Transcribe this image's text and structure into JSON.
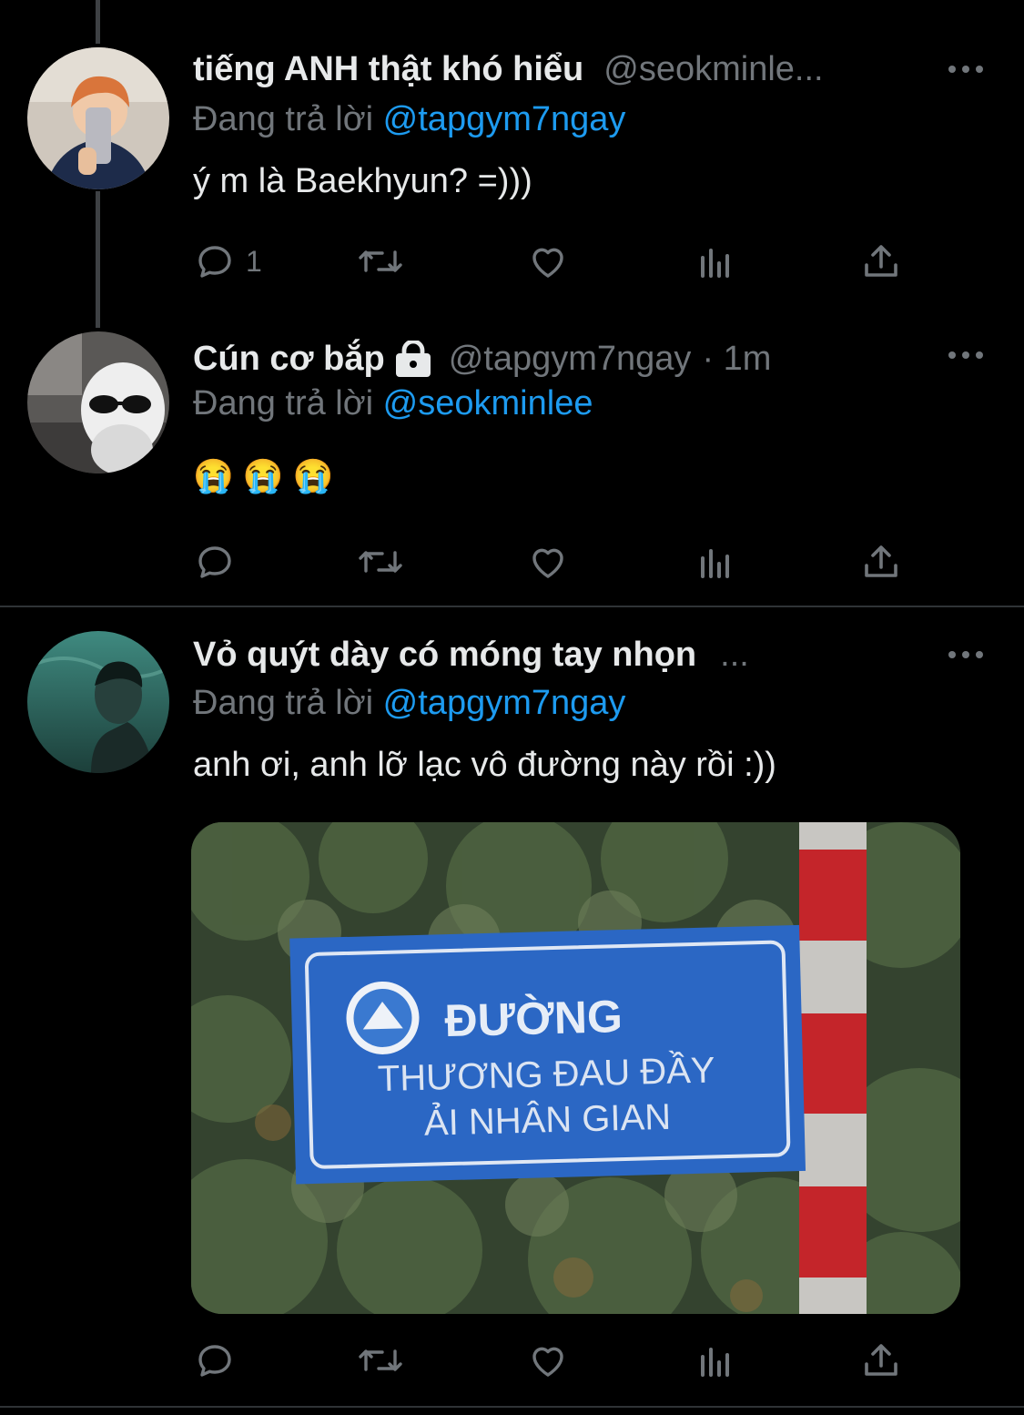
{
  "tweets": [
    {
      "display_name": "tiếng ANH thật khó hiểu",
      "handle": "@seokminle...",
      "reply_prefix": "Đang trả lời",
      "reply_to": "@tapgym7ngay",
      "text": "ý m là Baekhyun? =)))",
      "reply_count": "1"
    },
    {
      "display_name": "Cún cơ bắp",
      "handle": "@tapgym7ngay",
      "time": "· 1m",
      "reply_prefix": "Đang trả lời",
      "reply_to": "@seokminlee",
      "text": "😭 😭 😭"
    },
    {
      "display_name": "Vỏ quýt dày có móng tay nhọn",
      "handle": "...",
      "reply_prefix": "Đang trả lời",
      "reply_to": "@tapgym7ngay",
      "text": "anh ơi, anh lỡ lạc vô đường này rồi :))",
      "media": {
        "sign_line1": "ĐƯỜNG",
        "sign_line2": "THƯƠNG ĐAU ĐẦY",
        "sign_line3": "ẢI NHÂN GIAN"
      }
    }
  ],
  "colors": {
    "background": "#000000",
    "text": "#e7e9ea",
    "secondary": "#71767b",
    "accent": "#1d9bf0"
  },
  "icons": [
    "reply-icon",
    "retweet-icon",
    "like-icon",
    "views-icon",
    "share-icon",
    "more-icon",
    "lock-icon"
  ]
}
